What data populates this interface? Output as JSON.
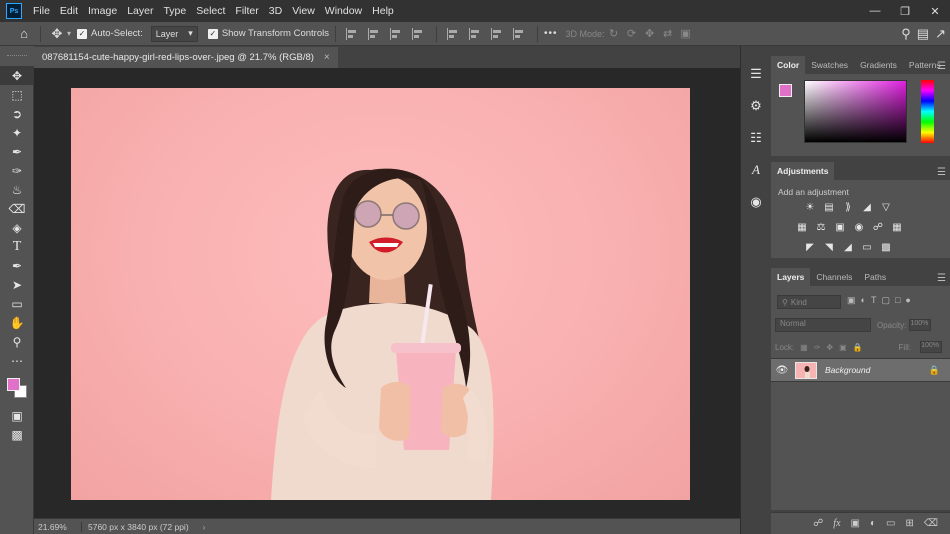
{
  "app": {
    "logo": "Ps"
  },
  "menu": [
    "File",
    "Edit",
    "Image",
    "Layer",
    "Type",
    "Select",
    "Filter",
    "3D",
    "View",
    "Window",
    "Help"
  ],
  "options_bar": {
    "auto_select_label": "Auto-Select:",
    "auto_select_checked": true,
    "target_value": "Layer",
    "show_transform_label": "Show Transform Controls",
    "show_transform_checked": true,
    "more_label": "•••",
    "mode_3d_label": "3D Mode:"
  },
  "document": {
    "tab_title": "087681154-cute-happy-girl-red-lips-over-.jpeg @ 21.7% (RGB/8)",
    "close": "×"
  },
  "status": {
    "zoom": "21.69%",
    "info": "5760 px x 3840 px (72 ppi)",
    "arrow": "›"
  },
  "colors": {
    "foreground": "#e070c8",
    "background": "#ffffff",
    "canvas_bg": "#f9b0b0",
    "workspace": "#282828"
  },
  "panels": {
    "color_tabs": [
      "Color",
      "Swatches",
      "Gradients",
      "Patterns"
    ],
    "adjustments_title": "Adjustments",
    "adjustments_hint": "Add an adjustment",
    "layers_tabs": [
      "Layers",
      "Channels",
      "Paths"
    ],
    "layer_search_placeholder": "Kind",
    "blend_mode": "Normal",
    "opacity_label": "Opacity:",
    "opacity_value": "100%",
    "lock_label": "Lock:",
    "fill_label": "Fill:",
    "fill_value": "100%",
    "layers": [
      {
        "name": "Background",
        "visible": true,
        "locked": true
      }
    ]
  }
}
